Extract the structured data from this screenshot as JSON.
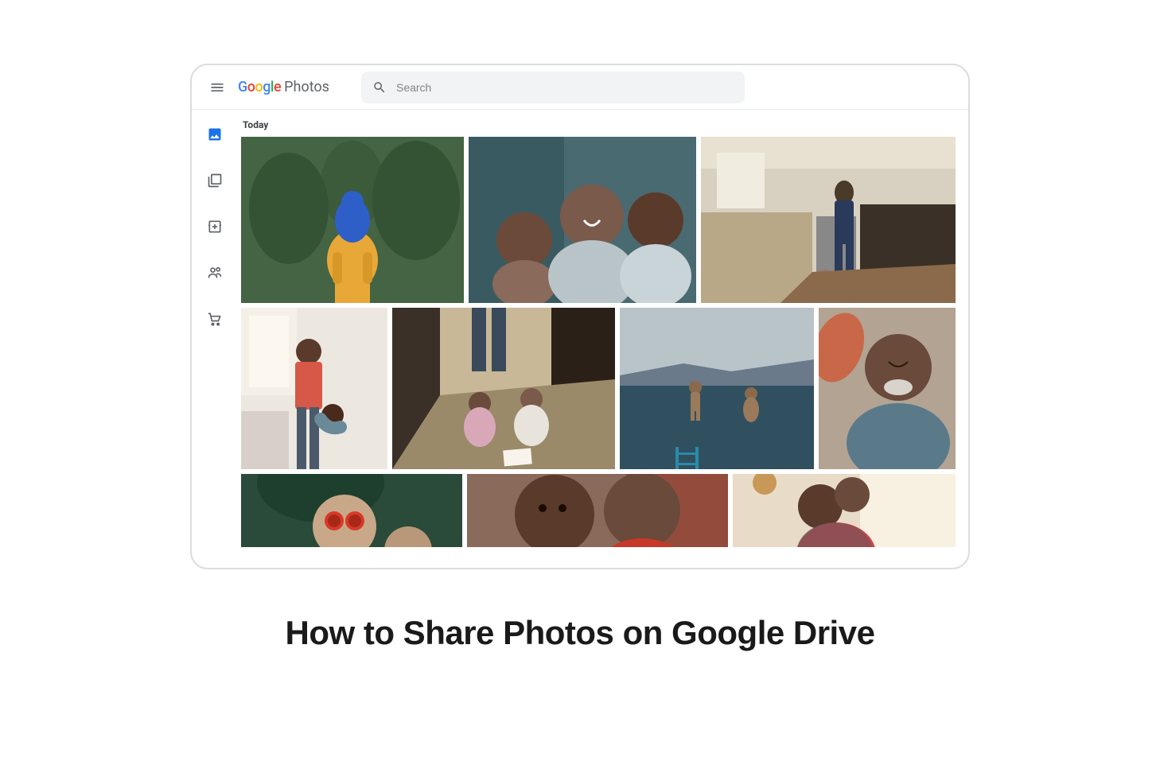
{
  "header": {
    "logo": {
      "google": "Google",
      "photos": "Photos"
    },
    "search": {
      "placeholder": "Search"
    }
  },
  "sidebar": {
    "items": [
      {
        "name": "photos",
        "active": true
      },
      {
        "name": "albums",
        "active": false
      },
      {
        "name": "for-you",
        "active": false
      },
      {
        "name": "sharing",
        "active": false
      },
      {
        "name": "print-store",
        "active": false
      }
    ]
  },
  "section_label": "Today",
  "caption": "How to Share Photos on Google Drive"
}
